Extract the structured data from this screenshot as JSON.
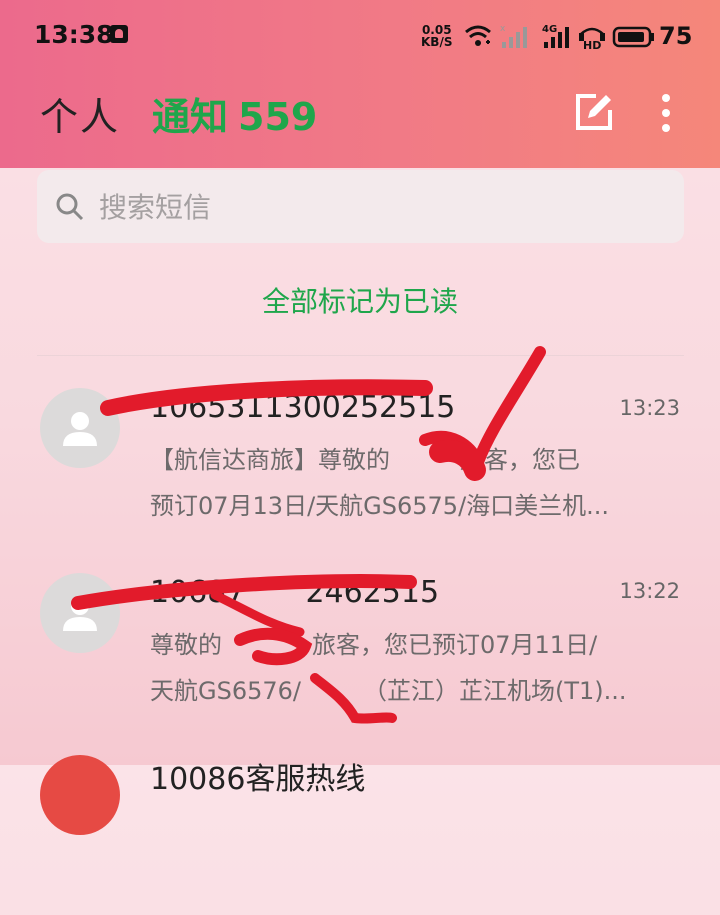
{
  "status_bar": {
    "time": "13:38",
    "net_speed_value": "0.05",
    "net_speed_unit": "KB/S",
    "network_label": "4G",
    "hd_label": "HD",
    "battery": "75"
  },
  "header": {
    "tab_personal": "个人",
    "tab_notify": "通知",
    "notify_count": "559",
    "accent_color": "#1fa64b"
  },
  "search": {
    "placeholder": "搜索短信"
  },
  "mark_all_read": "全部标记为已读",
  "messages": [
    {
      "sender": "1065311300252515",
      "time": "13:23",
      "line1": "【航信达商旅】尊敬的",
      "line1_tail": "旅客，您已",
      "line2": "预订07月13日/天航GS6575/海口美兰机..."
    },
    {
      "sender": "10687",
      "sender_tail": "2462515",
      "time": "13:22",
      "line1": "尊敬的",
      "line1_tail": "旅客，您已预订07月11日/",
      "line2": "天航GS6576/",
      "line2_tail": "（芷江）芷江机场(T1)..."
    },
    {
      "sender": "10086",
      "sender_tail": "客服热线"
    }
  ]
}
